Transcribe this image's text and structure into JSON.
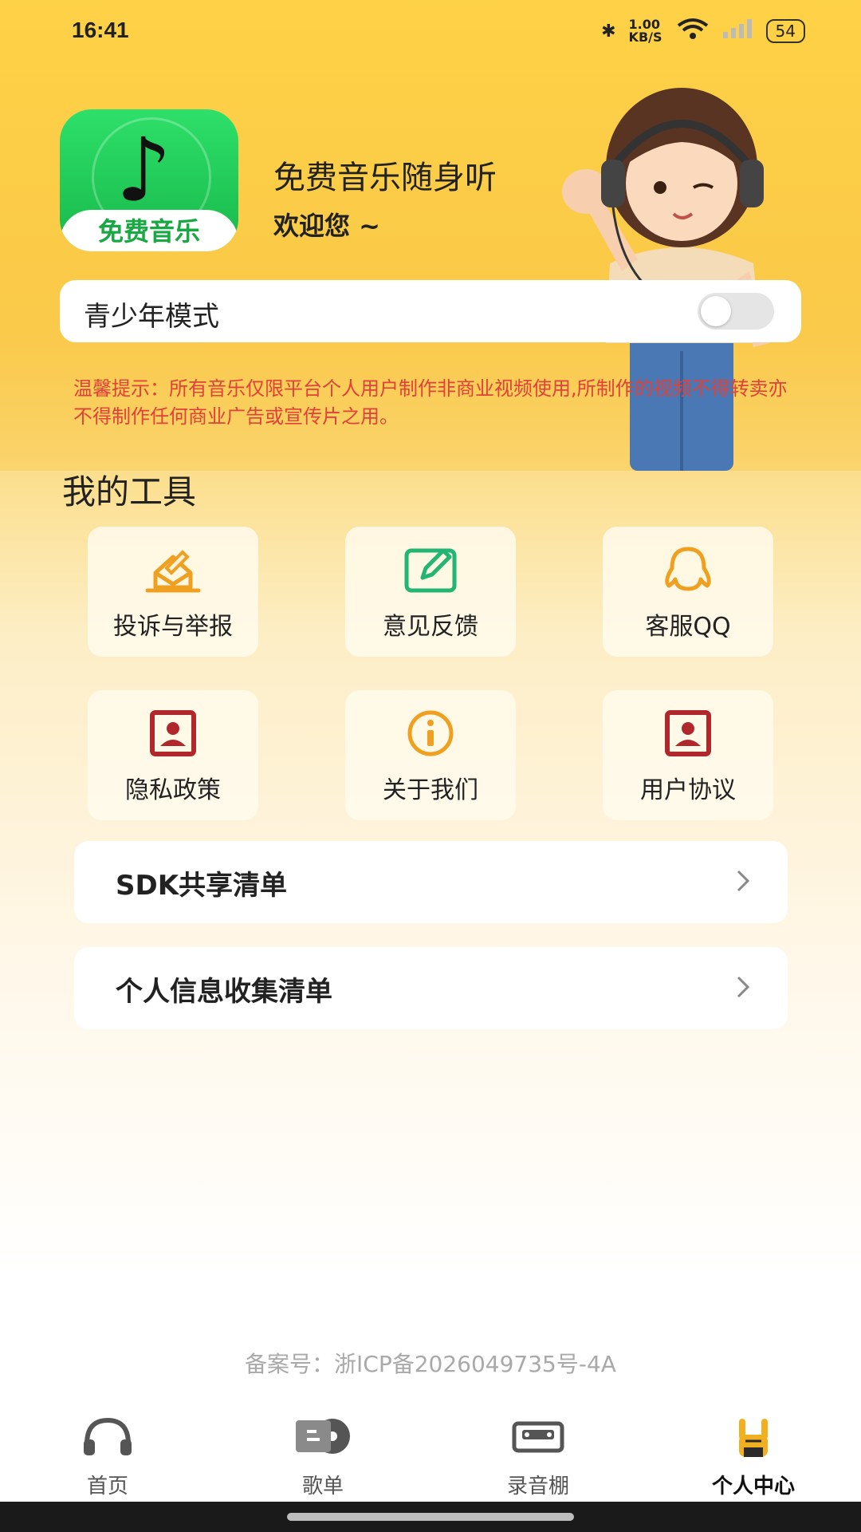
{
  "status_bar": {
    "time": "16:41",
    "net_speed": "1.00 KB/S",
    "battery": "54"
  },
  "header": {
    "logo_text": "免费音乐",
    "app_name": "免费音乐随身听",
    "welcome": "欢迎您 ~"
  },
  "teen_mode": {
    "label": "青少年模式",
    "enabled": false
  },
  "notice": "温馨提示：所有音乐仅限平台个人用户制作非商业视频使用,所制作的视频不得转卖亦不得制作任何商业广告或宣传片之用。",
  "tools": {
    "title": "我的工具",
    "items": [
      {
        "label": "投诉与举报",
        "icon": "complaint-icon"
      },
      {
        "label": "意见反馈",
        "icon": "edit-feedback-icon"
      },
      {
        "label": "客服QQ",
        "icon": "qq-icon"
      },
      {
        "label": "隐私政策",
        "icon": "privacy-icon"
      },
      {
        "label": "关于我们",
        "icon": "info-icon"
      },
      {
        "label": "用户协议",
        "icon": "agreement-icon"
      }
    ]
  },
  "lists": [
    {
      "label": "SDK共享清单"
    },
    {
      "label": "个人信息收集清单"
    }
  ],
  "icp": "备案号：浙ICP备2026049735号-4A",
  "tabbar": {
    "items": [
      {
        "label": "首页",
        "icon": "headphones-icon"
      },
      {
        "label": "歌单",
        "icon": "vinyl-icon"
      },
      {
        "label": "录音棚",
        "icon": "cassette-icon"
      },
      {
        "label": "个人中心",
        "icon": "rock-hand-icon",
        "active": true
      }
    ]
  },
  "colors": {
    "accent_orange": "#f0a020",
    "accent_green": "#22b573",
    "accent_red": "#b0282c",
    "notice_red": "#e0413a"
  }
}
